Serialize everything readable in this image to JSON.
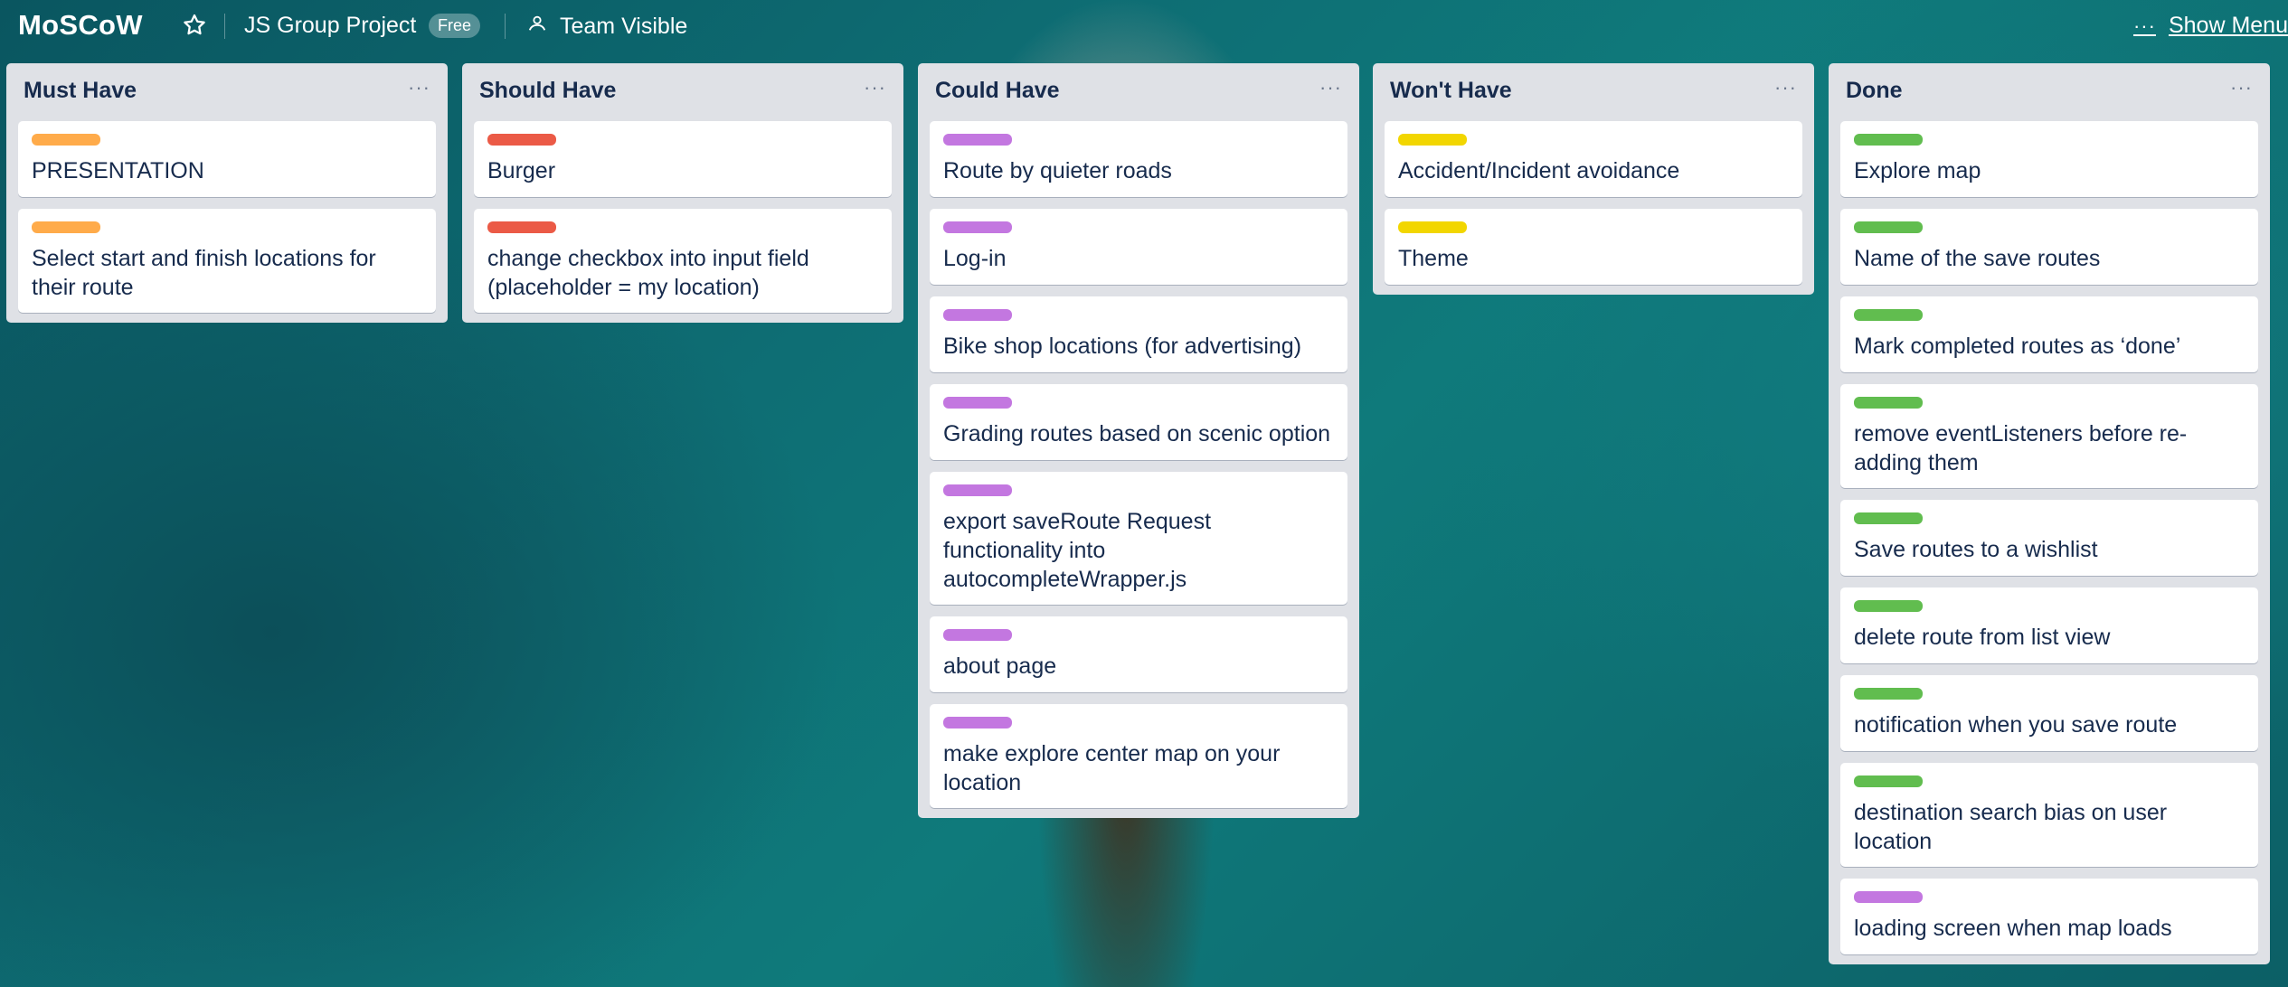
{
  "header": {
    "board_title": "MoSCoW",
    "project_name": "JS Group Project",
    "plan_badge": "Free",
    "visibility": "Team Visible",
    "show_menu": "Show Menu",
    "menu_dots": "···"
  },
  "colors": {
    "orange": "#ffab4a",
    "red": "#eb5a46",
    "purple": "#c377e0",
    "yellow": "#f2d600",
    "green": "#61bd4f"
  },
  "lists": [
    {
      "title": "Must Have",
      "menu": "···",
      "cards": [
        {
          "label_color": "orange",
          "title": "PRESENTATION"
        },
        {
          "label_color": "orange",
          "title": "Select start and finish locations for their route"
        }
      ]
    },
    {
      "title": "Should Have",
      "menu": "···",
      "cards": [
        {
          "label_color": "red",
          "title": "Burger"
        },
        {
          "label_color": "red",
          "title": "change checkbox into input field (placeholder = my location)"
        }
      ]
    },
    {
      "title": "Could Have",
      "menu": "···",
      "cards": [
        {
          "label_color": "purple",
          "title": "Route by quieter roads"
        },
        {
          "label_color": "purple",
          "title": "Log-in"
        },
        {
          "label_color": "purple",
          "title": "Bike shop locations (for advertising)"
        },
        {
          "label_color": "purple",
          "title": "Grading routes based on scenic option"
        },
        {
          "label_color": "purple",
          "title": "export saveRoute Request functionality into autocompleteWrapper.js"
        },
        {
          "label_color": "purple",
          "title": "about page"
        },
        {
          "label_color": "purple",
          "title": "make explore center map on your location"
        }
      ]
    },
    {
      "title": "Won't Have",
      "menu": "···",
      "cards": [
        {
          "label_color": "yellow",
          "title": "Accident/Incident avoidance"
        },
        {
          "label_color": "yellow",
          "title": "Theme"
        }
      ]
    },
    {
      "title": "Done",
      "menu": "···",
      "cards": [
        {
          "label_color": "green",
          "title": "Explore map"
        },
        {
          "label_color": "green",
          "title": "Name of the save routes"
        },
        {
          "label_color": "green",
          "title": "Mark completed routes as ‘done’"
        },
        {
          "label_color": "green",
          "title": "remove eventListeners before re-adding them"
        },
        {
          "label_color": "green",
          "title": "Save routes to a wishlist"
        },
        {
          "label_color": "green",
          "title": "delete route from list view"
        },
        {
          "label_color": "green",
          "title": "notification when you save route"
        },
        {
          "label_color": "green",
          "title": "destination search bias on user location"
        },
        {
          "label_color": "purple",
          "title": "loading screen when map loads"
        }
      ]
    }
  ]
}
